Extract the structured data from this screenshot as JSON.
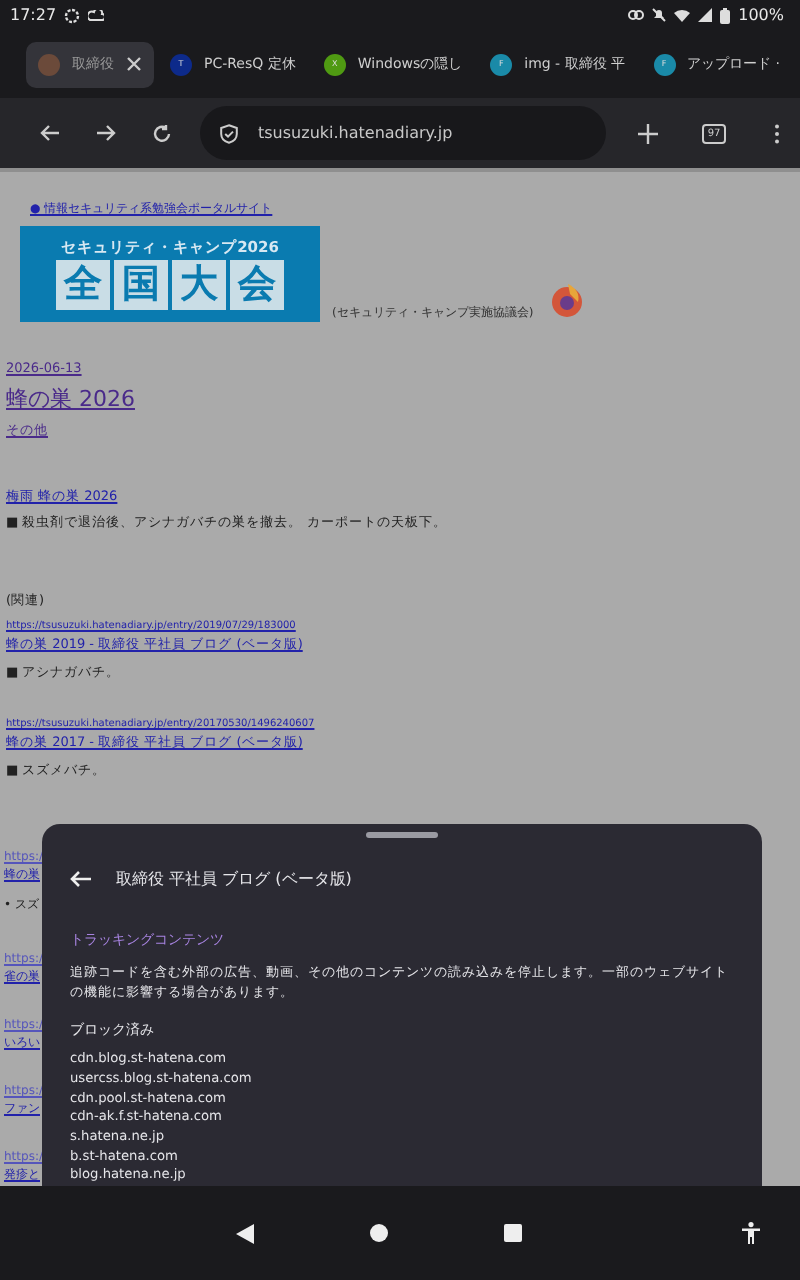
{
  "status_bar": {
    "time": "17:27",
    "battery": "100%"
  },
  "tabs": [
    {
      "title": "取締役",
      "selected": true
    },
    {
      "title": "PC-ResQ 定休",
      "favicon": "T",
      "color": "#0d2a8a",
      "selected": false
    },
    {
      "title": "Windowsの隠し",
      "favicon": "X",
      "color": "#4f9a12",
      "selected": false
    },
    {
      "title": "img - 取締役 平",
      "favicon": "F",
      "color": "#1a8aa8",
      "selected": false
    },
    {
      "title": "アップロード ·",
      "favicon": "F",
      "color": "#1a8aa8",
      "selected": false
    }
  ],
  "toolbar": {
    "url": "tsusuzuki.hatenadiary.jp",
    "tab_count": "97"
  },
  "page": {
    "portal_link": "● 情報セキュリティ系勉強会ポータルサイト",
    "banner": {
      "line1": "セキュリティ・キャンプ2026",
      "line2": "全国大会"
    },
    "banner_caption": "(セキュリティ・キャンプ実施協議会)",
    "date": "2026-06-13",
    "title": "蜂の巣 2026",
    "category": "その他",
    "subtitle": "梅雨 蜂の巣 2026",
    "blocks": [
      {
        "kind": "bullet",
        "text": "■ 殺虫剤で退治後、アシナガバチの巣を撤去。 カーポートの天板下。"
      },
      {
        "kind": "text",
        "text": "(関連)"
      },
      {
        "kind": "url",
        "text": "https://tsusuzuki.hatenadiary.jp/entry/2019/07/29/183000"
      },
      {
        "kind": "link",
        "text": "蜂の巣 2019 - 取締役 平社員 ブログ (ベータ版)"
      },
      {
        "kind": "bullet",
        "text": "■ アシナガバチ。"
      },
      {
        "kind": "url",
        "text": "https://tsusuzuki.hatenadiary.jp/entry/20170530/1496240607"
      },
      {
        "kind": "link",
        "text": "蜂の巣 2017 - 取締役 平社員 ブログ (ベータ版)"
      },
      {
        "kind": "bullet",
        "text": "■ スズメバチ。"
      }
    ],
    "partial_lines": [
      {
        "kind": "url",
        "text": "https:/"
      },
      {
        "kind": "link",
        "text": "蜂の巣"
      },
      {
        "kind": "bullet",
        "text": "• スズ"
      },
      {
        "kind": "url",
        "text": "https:/"
      },
      {
        "kind": "link",
        "text": "雀の巣"
      },
      {
        "kind": "url",
        "text": "https:/"
      },
      {
        "kind": "link",
        "text": "いろい"
      },
      {
        "kind": "url",
        "text": "https:/"
      },
      {
        "kind": "link",
        "text": "ファン"
      },
      {
        "kind": "url",
        "text": "https:/"
      },
      {
        "kind": "link",
        "text": "発疹と"
      }
    ]
  },
  "sheet": {
    "title": "取締役 平社員 ブログ (ベータ版)",
    "section": "トラッキングコンテンツ",
    "description": "追跡コードを含む外部の広告、動画、その他のコンテンツの読み込みを停止します。一部のウェブサイトの機能に影響する場合があります。",
    "blocked_heading": "ブロック済み",
    "blocked": [
      "cdn.blog.st-hatena.com",
      "usercss.blog.st-hatena.com",
      "cdn.pool.st-hatena.com",
      "cdn-ak.f.st-hatena.com",
      "s.hatena.ne.jp",
      "b.st-hatena.com",
      "blog.hatena.ne.jp"
    ]
  }
}
